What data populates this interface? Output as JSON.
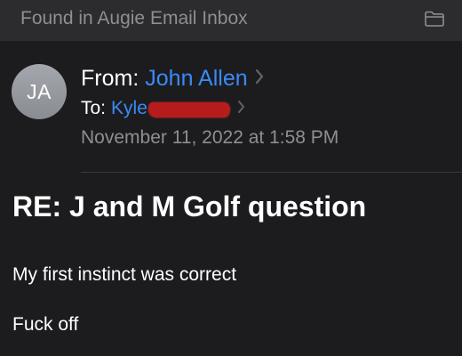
{
  "banner": {
    "text": "Found in Augie Email Inbox",
    "icon": "folder-icon"
  },
  "sender": {
    "avatar_initials": "JA",
    "from_label": "From:",
    "from_name": "John Allen",
    "to_label": "To:",
    "to_name": "Kyle",
    "to_name_redacted": true,
    "date": "November 11, 2022 at 1:58 PM"
  },
  "message": {
    "subject": "RE: J and M Golf question",
    "body_lines": [
      "My first instinct was correct",
      "Fuck off"
    ]
  },
  "colors": {
    "background": "#1c1c1e",
    "banner_background": "#2c2c2e",
    "link_blue": "#3a8af7",
    "secondary_gray": "#8e8e93",
    "redaction_red": "#b71c1c"
  }
}
